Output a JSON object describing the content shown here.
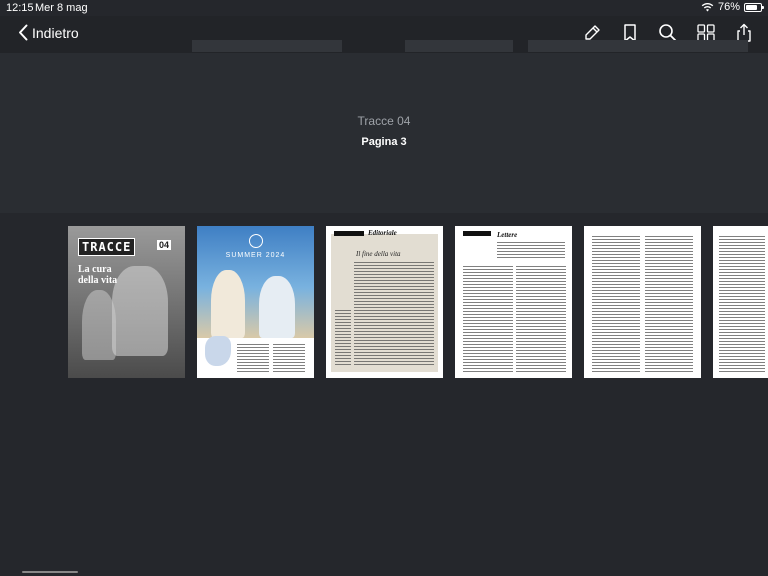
{
  "status_bar": {
    "time": "12:15",
    "date": "Mer 8 mag",
    "battery": "76%",
    "battery_level": 0.76
  },
  "nav": {
    "back_label": "Indietro"
  },
  "toolbar": {
    "icons": [
      "annotate-icon",
      "bookmark-icon",
      "search-icon",
      "pages-grid-icon",
      "share-icon"
    ]
  },
  "header": {
    "issue_title": "Tracce 04",
    "page_label": "Pagina 3"
  },
  "thumbnails": {
    "cover_title": "TRACCE",
    "cover_number": "04",
    "cover_headline": "La cura della vita",
    "summer_text": "SUMMER 2024",
    "editorial_heading": "Editoriale",
    "editorial_subtitle": "Il fine della vita",
    "letters_heading": "Lettere"
  }
}
